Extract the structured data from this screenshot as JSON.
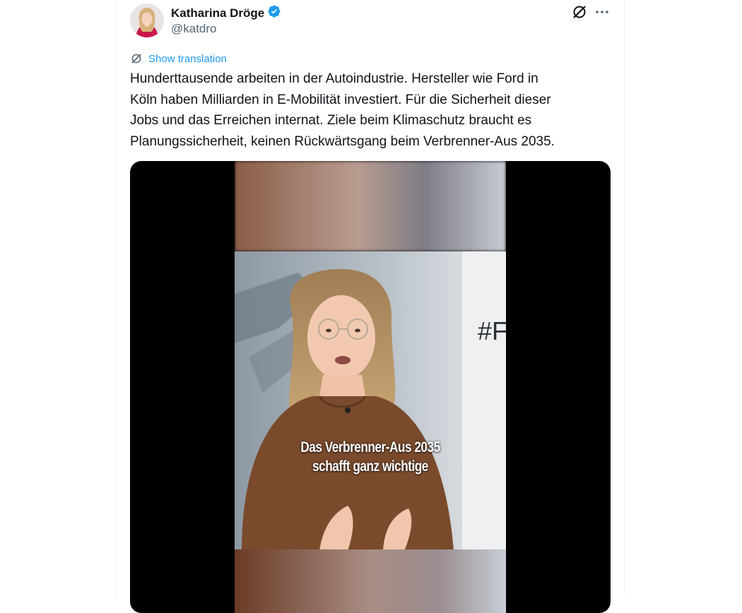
{
  "author": {
    "name": "Katharina Dröge",
    "handle": "@katdro",
    "verified": true
  },
  "actions": {
    "grok_icon": "grok-icon",
    "more_icon": "more-options-icon"
  },
  "translation": {
    "label": "Show translation"
  },
  "tweet": {
    "lines": [
      "Hunderttausende arbeiten in der Autoindustrie. Hersteller wie Ford in",
      "Köln haben Milliarden in E-Mobilität investiert. Für die Sicherheit dieser",
      "Jobs und das Erreichen internat. Ziele beim Klimaschutz braucht es",
      "Planungssicherheit, keinen Rückwärtsgang beim Verbrenner-Aus 2035."
    ]
  },
  "video": {
    "background_text": "#F",
    "caption_lines": [
      "Das Verbrenner-Aus 2035",
      "schafft ganz wichtige"
    ]
  },
  "colors": {
    "accent": "#1d9bf0",
    "secondary_text": "#536471",
    "primary_text": "#0f1419"
  }
}
